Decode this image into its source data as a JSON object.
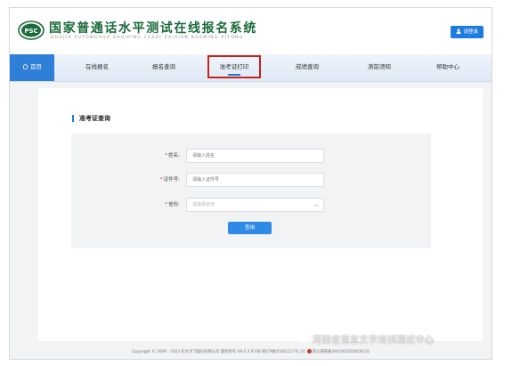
{
  "header": {
    "logo_text": "PSC",
    "title": "国家普通话水平测试在线报名系统",
    "subtitle": "GUOJIA PUTONGHUA SHUIPING CESHI ZAIXIAN BAOMING XITONG",
    "login_label": "请登录"
  },
  "nav": {
    "home": "首页",
    "items": [
      "在线报名",
      "报名查询",
      "准考证打印",
      "成绩查询",
      "测前须知",
      "帮助中心"
    ],
    "active_index": 2
  },
  "main": {
    "section_title": "准考证查询",
    "form": {
      "name_label": "姓名:",
      "name_placeholder": "请输入姓名",
      "id_label": "证件号:",
      "id_placeholder": "请输入证件号",
      "province_label": "省份:",
      "province_placeholder": "请选择省份",
      "submit_label": "查询"
    }
  },
  "footer": {
    "text": "Copyright © 2006 - 2023 科大讯飞股份有限公司 版权所有 V8.6.3.9338  皖ICP备05001217号-24",
    "police": "皖公网安备34019202000362号"
  },
  "watermark": "河南省语言文字培训测试中心",
  "colors": {
    "accent": "#1e7be0",
    "brand_green": "#1b6b3a",
    "highlight": "#c9211e"
  }
}
